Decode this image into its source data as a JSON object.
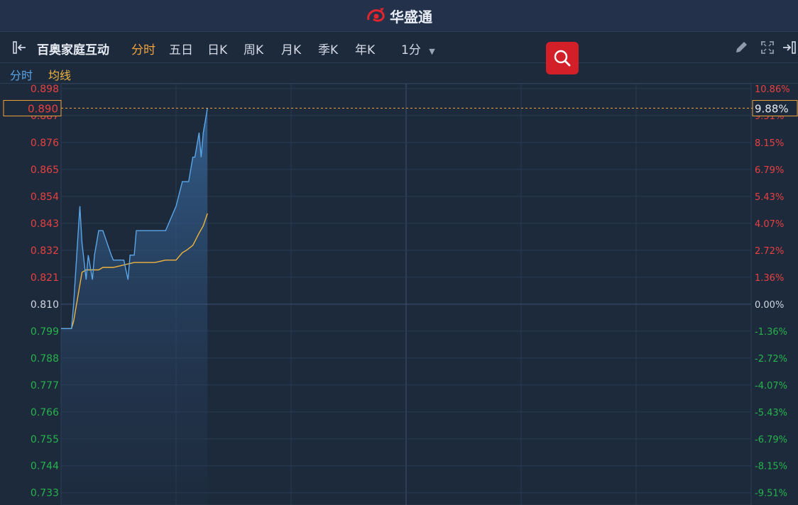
{
  "app": {
    "title": "华盛通"
  },
  "toolbar": {
    "stock_name": "百奥家庭互动",
    "periods": [
      "分时",
      "五日",
      "日K",
      "周K",
      "月K",
      "季K",
      "年K"
    ],
    "active_period": "分时",
    "interval": "1分"
  },
  "legend": {
    "price_label": "分时",
    "avg_label": "均线"
  },
  "colors": {
    "up": "#e94040",
    "down": "#26b34b",
    "flat": "#cfd6e2",
    "price_line": "#5aa6e8",
    "avg_line": "#f0b43c",
    "accent": "#f2a33c"
  },
  "icons": [
    "collapse-left-icon",
    "pencil-icon",
    "fullscreen-icon",
    "collapse-right-icon",
    "search-icon"
  ],
  "chart_data": {
    "type": "line",
    "prev_close": 0.81,
    "ylim": [
      0.728,
      0.9
    ],
    "y_ticks": [
      "0.898",
      "0.887",
      "0.876",
      "0.865",
      "0.854",
      "0.843",
      "0.832",
      "0.821",
      "0.810",
      "0.799",
      "0.788",
      "0.777",
      "0.766",
      "0.755",
      "0.744",
      "0.733"
    ],
    "pct_ticks": [
      "10.86%",
      "9.51%",
      "8.15%",
      "6.79%",
      "5.43%",
      "4.07%",
      "2.72%",
      "1.36%",
      "0.00%",
      "-1.36%",
      "-2.72%",
      "-4.07%",
      "-5.43%",
      "-6.79%",
      "-8.15%",
      "-9.51%"
    ],
    "current_price": "0.890",
    "current_pct": "9.88%",
    "session_minutes": 330,
    "series": [
      {
        "key": "price",
        "x": [
          0,
          5,
          6,
          9,
          10,
          12,
          13,
          15,
          16,
          18,
          20,
          24,
          25,
          30,
          32,
          33,
          35,
          36,
          38,
          39,
          40,
          42,
          45,
          46,
          48,
          50,
          55,
          58,
          61,
          63,
          64,
          66,
          67,
          68,
          70
        ],
        "values": [
          0.8,
          0.8,
          0.81,
          0.85,
          0.835,
          0.82,
          0.83,
          0.82,
          0.83,
          0.84,
          0.84,
          0.83,
          0.828,
          0.828,
          0.82,
          0.83,
          0.83,
          0.84,
          0.84,
          0.84,
          0.84,
          0.84,
          0.84,
          0.84,
          0.84,
          0.84,
          0.85,
          0.86,
          0.86,
          0.87,
          0.87,
          0.88,
          0.87,
          0.88,
          0.89
        ]
      },
      {
        "key": "avg",
        "x": [
          0,
          5,
          6,
          8,
          10,
          12,
          15,
          18,
          20,
          25,
          30,
          35,
          40,
          45,
          50,
          55,
          58,
          60,
          63,
          66,
          68,
          70
        ],
        "values": [
          0.8,
          0.8,
          0.803,
          0.813,
          0.823,
          0.824,
          0.824,
          0.824,
          0.825,
          0.825,
          0.826,
          0.827,
          0.827,
          0.827,
          0.828,
          0.828,
          0.831,
          0.832,
          0.834,
          0.839,
          0.842,
          0.847
        ]
      }
    ]
  }
}
